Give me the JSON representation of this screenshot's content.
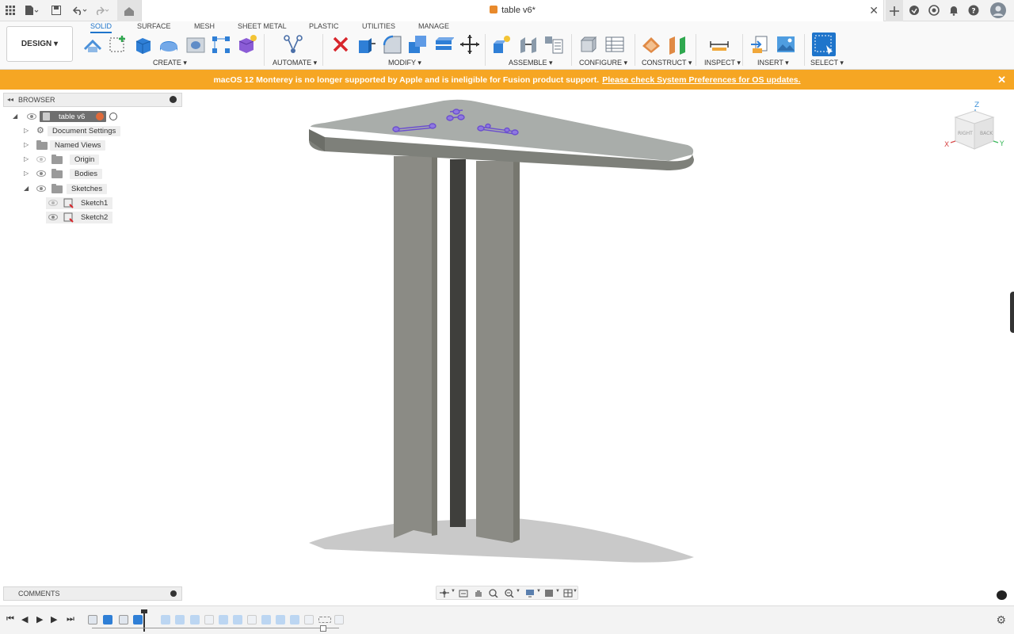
{
  "titlebar": {
    "doc_title": "table v6*",
    "icons": [
      "grid-icon",
      "file-icon",
      "save-icon",
      "undo-icon",
      "redo-icon",
      "home-icon",
      "new-tab-icon",
      "extension-icon",
      "job-status-icon",
      "notifications-icon",
      "help-icon",
      "avatar"
    ]
  },
  "toolbar": {
    "design_label": "DESIGN ▾",
    "tabs": [
      "SOLID",
      "SURFACE",
      "MESH",
      "SHEET METAL",
      "PLASTIC",
      "UTILITIES",
      "MANAGE"
    ],
    "active_tab": "SOLID",
    "groups": [
      "CREATE ▾",
      "AUTOMATE ▾",
      "MODIFY ▾",
      "ASSEMBLE ▾",
      "CONFIGURE ▾",
      "CONSTRUCT ▾",
      "INSPECT ▾",
      "INSERT ▾",
      "SELECT ▾"
    ]
  },
  "banner": {
    "message": "macOS 12 Monterey is no longer supported by Apple and is ineligible for Fusion product support.",
    "link": "Please check System Preferences for OS updates."
  },
  "browser": {
    "title": "BROWSER",
    "root": "table v6",
    "items": [
      "Document Settings",
      "Named Views",
      "Origin",
      "Bodies",
      "Sketches"
    ],
    "sketches": [
      "Sketch1",
      "Sketch2"
    ]
  },
  "comments": {
    "title": "COMMENTS"
  },
  "viewcube": {
    "right": "RIGHT",
    "back": "BACK",
    "x": "X",
    "y": "Y",
    "z": "Z"
  },
  "colors": {
    "accent": "#1f75cb",
    "banner": "#f6a623",
    "model": "#8a8a84",
    "top": "#a9adaa"
  }
}
